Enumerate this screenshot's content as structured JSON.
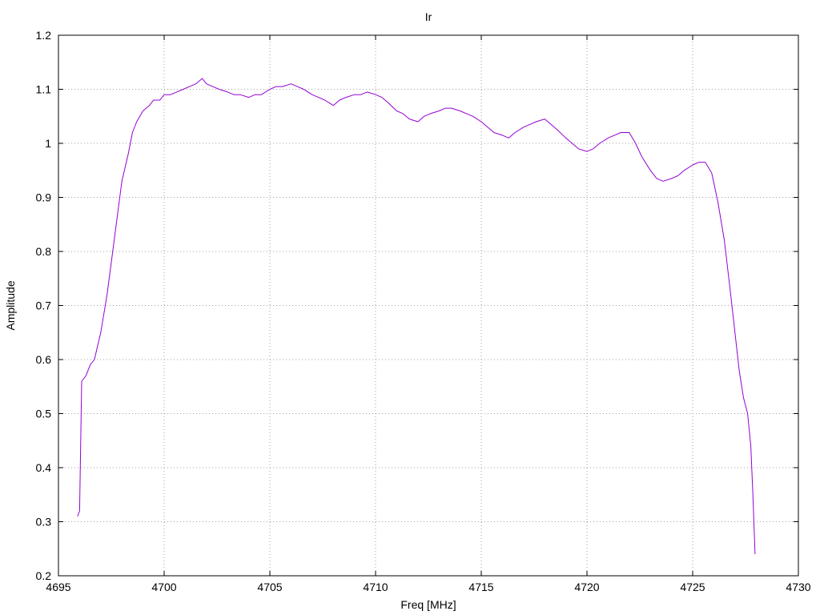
{
  "chart_data": {
    "type": "line",
    "title": "Ir",
    "xlabel": "Freq [MHz]",
    "ylabel": "Amplitude",
    "xlim": [
      4695,
      4730
    ],
    "ylim": [
      0.2,
      1.2
    ],
    "x_ticks": [
      4695,
      4700,
      4705,
      4710,
      4715,
      4720,
      4725,
      4730
    ],
    "x_tick_labels": [
      "4695",
      "4700",
      "4705",
      "4710",
      "4715",
      "4720",
      "4725",
      "4730"
    ],
    "y_ticks": [
      0.2,
      0.3,
      0.4,
      0.5,
      0.6,
      0.7,
      0.8,
      0.9,
      1.0,
      1.1,
      1.2
    ],
    "y_tick_labels": [
      "0.2",
      "0.3",
      "0.4",
      "0.5",
      "0.6",
      "0.7",
      "0.8",
      "0.9",
      "1",
      "1.1",
      "1.2"
    ],
    "grid": true,
    "grid_style": "dotted",
    "line_color": "#9400d3",
    "series": [
      {
        "x": [
          4695.9,
          4696.0,
          4696.1,
          4696.3,
          4696.5,
          4696.7,
          4697.0,
          4697.3,
          4697.5,
          4697.8,
          4698.0,
          4698.3,
          4698.5,
          4698.7,
          4699.0,
          4699.3,
          4699.5,
          4699.8,
          4700.0,
          4700.3,
          4700.6,
          4700.9,
          4701.2,
          4701.5,
          4701.8,
          4702.0,
          4702.3,
          4702.6,
          4703.0,
          4703.3,
          4703.6,
          4704.0,
          4704.3,
          4704.6,
          4705.0,
          4705.3,
          4705.6,
          4706.0,
          4706.3,
          4706.6,
          4707.0,
          4707.3,
          4707.6,
          4708.0,
          4708.3,
          4708.6,
          4709.0,
          4709.3,
          4709.6,
          4710.0,
          4710.3,
          4710.6,
          4711.0,
          4711.3,
          4711.6,
          4712.0,
          4712.3,
          4712.6,
          4713.0,
          4713.3,
          4713.6,
          4714.0,
          4714.3,
          4714.6,
          4715.0,
          4715.3,
          4715.6,
          4716.0,
          4716.3,
          4716.6,
          4717.0,
          4717.3,
          4717.6,
          4718.0,
          4718.3,
          4718.6,
          4719.0,
          4719.3,
          4719.6,
          4720.0,
          4720.3,
          4720.6,
          4721.0,
          4721.3,
          4721.6,
          4722.0,
          4722.3,
          4722.6,
          4723.0,
          4723.3,
          4723.6,
          4724.0,
          4724.3,
          4724.6,
          4725.0,
          4725.3,
          4725.6,
          4725.9,
          4726.2,
          4726.5,
          4726.8,
          4727.0,
          4727.2,
          4727.4,
          4727.6,
          4727.75,
          4727.85,
          4727.95
        ],
        "y": [
          0.31,
          0.32,
          0.56,
          0.57,
          0.59,
          0.6,
          0.65,
          0.72,
          0.78,
          0.87,
          0.93,
          0.98,
          1.02,
          1.04,
          1.06,
          1.07,
          1.08,
          1.08,
          1.09,
          1.09,
          1.095,
          1.1,
          1.105,
          1.11,
          1.12,
          1.11,
          1.105,
          1.1,
          1.095,
          1.09,
          1.09,
          1.085,
          1.09,
          1.09,
          1.1,
          1.105,
          1.105,
          1.11,
          1.105,
          1.1,
          1.09,
          1.085,
          1.08,
          1.07,
          1.08,
          1.085,
          1.09,
          1.09,
          1.095,
          1.09,
          1.085,
          1.075,
          1.06,
          1.055,
          1.045,
          1.04,
          1.05,
          1.055,
          1.06,
          1.065,
          1.065,
          1.06,
          1.055,
          1.05,
          1.04,
          1.03,
          1.02,
          1.015,
          1.01,
          1.02,
          1.03,
          1.035,
          1.04,
          1.045,
          1.035,
          1.025,
          1.01,
          1.0,
          0.99,
          0.985,
          0.99,
          1.0,
          1.01,
          1.015,
          1.02,
          1.02,
          1.0,
          0.975,
          0.95,
          0.935,
          0.93,
          0.935,
          0.94,
          0.95,
          0.96,
          0.965,
          0.965,
          0.945,
          0.89,
          0.82,
          0.72,
          0.65,
          0.58,
          0.53,
          0.5,
          0.44,
          0.35,
          0.24
        ]
      }
    ]
  }
}
